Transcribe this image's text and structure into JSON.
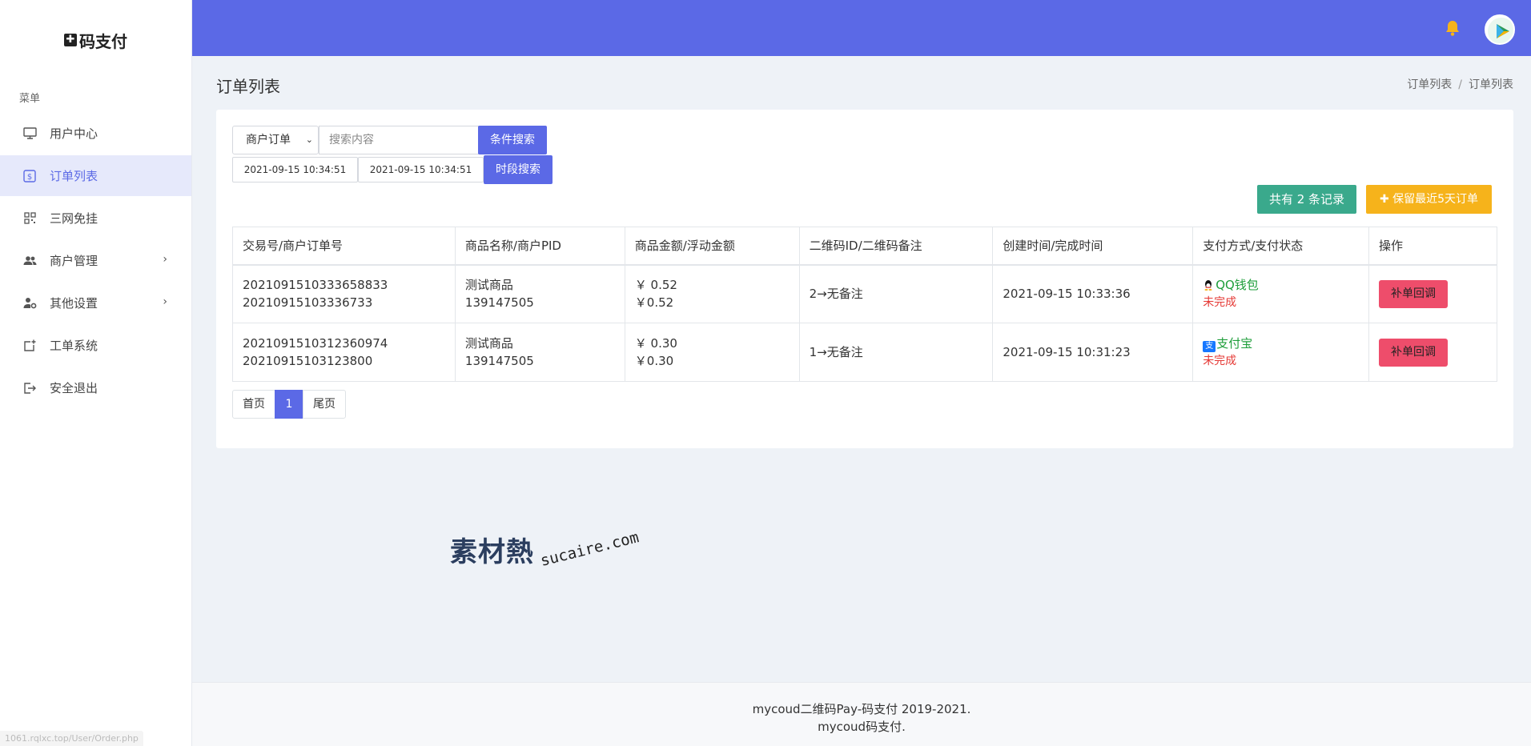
{
  "app": {
    "brand": "码支付",
    "url_hint": "1061.rqlxc.top/User/Order.php"
  },
  "sidebar": {
    "menu_title": "菜单",
    "items": [
      {
        "label": "用户中心",
        "icon": "monitor-icon",
        "active": false,
        "has_submenu": false
      },
      {
        "label": "订单列表",
        "icon": "dollar-square-icon",
        "active": true,
        "has_submenu": false
      },
      {
        "label": "三网免挂",
        "icon": "qrcode-icon",
        "active": false,
        "has_submenu": false
      },
      {
        "label": "商户管理",
        "icon": "users-icon",
        "active": false,
        "has_submenu": true
      },
      {
        "label": "其他设置",
        "icon": "user-gear-icon",
        "active": false,
        "has_submenu": true
      },
      {
        "label": "工单系统",
        "icon": "ticket-add-icon",
        "active": false,
        "has_submenu": false
      },
      {
        "label": "安全退出",
        "icon": "logout-icon",
        "active": false,
        "has_submenu": false
      }
    ]
  },
  "header": {
    "page_title": "订单列表",
    "breadcrumb": [
      "订单列表",
      "订单列表"
    ]
  },
  "filters": {
    "select_value": "商户订单",
    "search_placeholder": "搜索内容",
    "search_button": "条件搜索",
    "date_start": "2021-09-15 10:34:51",
    "date_end": "2021-09-15 10:34:51",
    "date_button": "时段搜索"
  },
  "actions": {
    "record_count": "共有 2 条记录",
    "keep_button": "✚ 保留最近5天订单"
  },
  "table": {
    "headers": [
      "交易号/商户订单号",
      "商品名称/商户PID",
      "商品金额/浮动金额",
      "二维码ID/二维码备注",
      "创建时间/完成时间",
      "支付方式/支付状态",
      "操作"
    ],
    "rows": [
      {
        "trade_no": "2021091510333658833",
        "order_no": "20210915103336733",
        "product": "测试商品",
        "pid": "139147505",
        "amount": "￥ 0.52",
        "float_amount": "￥0.52",
        "qrcode": "2→无备注",
        "created": "2021-09-15 10:33:36",
        "pay_method": "QQ钱包",
        "pay_icon": "qq-icon",
        "pay_status": "未完成",
        "action": "补单回调"
      },
      {
        "trade_no": "2021091510312360974",
        "order_no": "20210915103123800",
        "product": "测试商品",
        "pid": "139147505",
        "amount": "￥ 0.30",
        "float_amount": "￥0.30",
        "qrcode": "1→无备注",
        "created": "2021-09-15 10:31:23",
        "pay_method": "支付宝",
        "pay_icon": "alipay-icon",
        "pay_status": "未完成",
        "action": "补单回调"
      }
    ]
  },
  "pagination": {
    "first": "首页",
    "current": "1",
    "last": "尾页"
  },
  "watermark": {
    "main": "素材熱",
    "sub": "sucaire.com"
  },
  "footer": {
    "line1": "mycoud二维码Pay-码支付 2019-2021.",
    "line2": "mycoud码支付."
  },
  "colors": {
    "primary": "#5b69e6",
    "teal": "#3aa98c",
    "amber": "#f6b31b",
    "danger": "#ee4d6b",
    "bell": "#f6b31b"
  }
}
